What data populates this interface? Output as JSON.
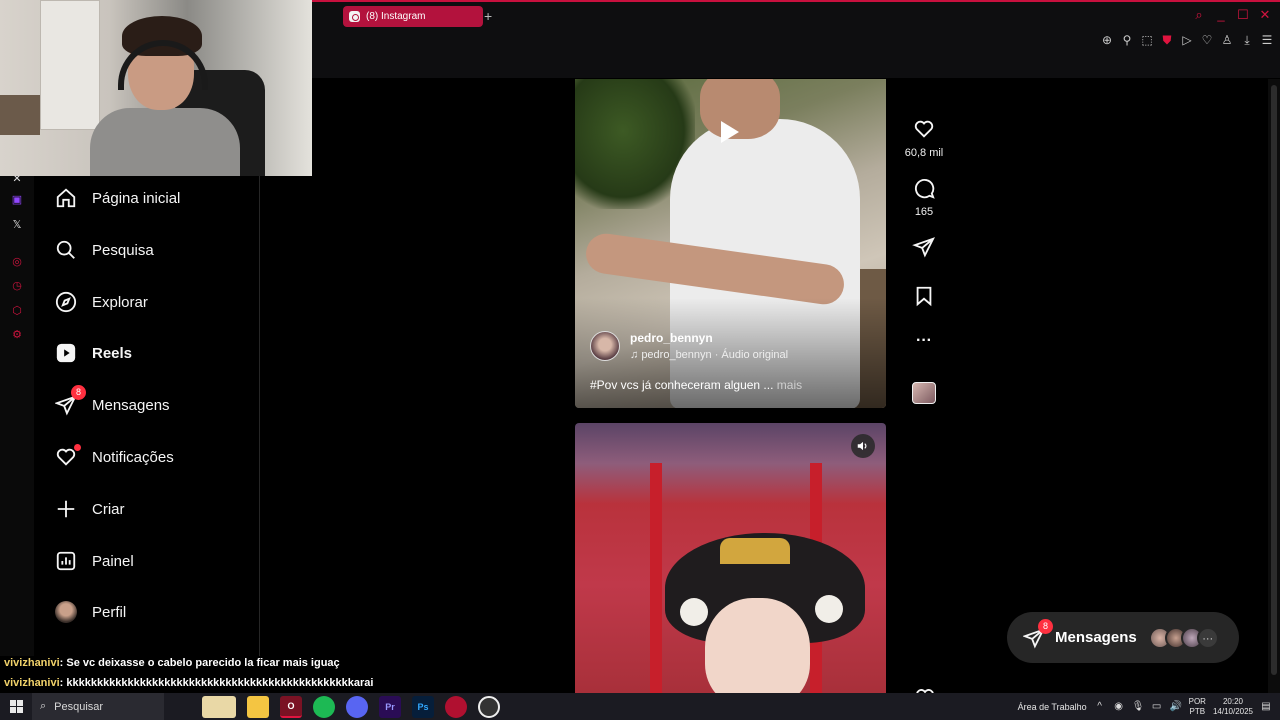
{
  "browser": {
    "tab_title": "(8) Instagram",
    "new_tab_icon": "plus-icon",
    "accent_color": "#c8103e"
  },
  "sidebar": {
    "items": [
      {
        "label": "Página inicial",
        "icon": "home-icon"
      },
      {
        "label": "Pesquisa",
        "icon": "search-icon"
      },
      {
        "label": "Explorar",
        "icon": "compass-icon"
      },
      {
        "label": "Reels",
        "icon": "reels-icon",
        "active": true
      },
      {
        "label": "Mensagens",
        "icon": "messages-icon",
        "badge": "8"
      },
      {
        "label": "Notificações",
        "icon": "heart-icon",
        "dot": true
      },
      {
        "label": "Criar",
        "icon": "plus-icon"
      },
      {
        "label": "Painel",
        "icon": "dashboard-icon"
      },
      {
        "label": "Perfil",
        "icon": "avatar"
      }
    ]
  },
  "reel": {
    "username": "pedro_bennyn",
    "audio": "pedro_bennyn · Áudio original",
    "caption": "#Pov vcs já conheceram alguen ...",
    "caption_more": "mais",
    "likes": "60,8 mil",
    "comments": "165"
  },
  "messages_pill": {
    "label": "Mensagens",
    "badge": "8",
    "more": "···"
  },
  "chat": [
    {
      "user": "vivizhanivi",
      "text": ": Se vc deixasse o cabelo parecido la ficar mais iguaç"
    },
    {
      "user": "vivizhanivi",
      "text": ": kkkkkkkkkkkkkkkkkkkkkkkkkkkkkkkkkkkkkkkkkkkkkkkarai"
    }
  ],
  "taskbar": {
    "search_placeholder": "Pesquisar",
    "desktop_label": "Área de Trabalho",
    "lang_top": "POR",
    "lang_bottom": "PTB",
    "time": "20:20",
    "date": "14/10/2025"
  }
}
